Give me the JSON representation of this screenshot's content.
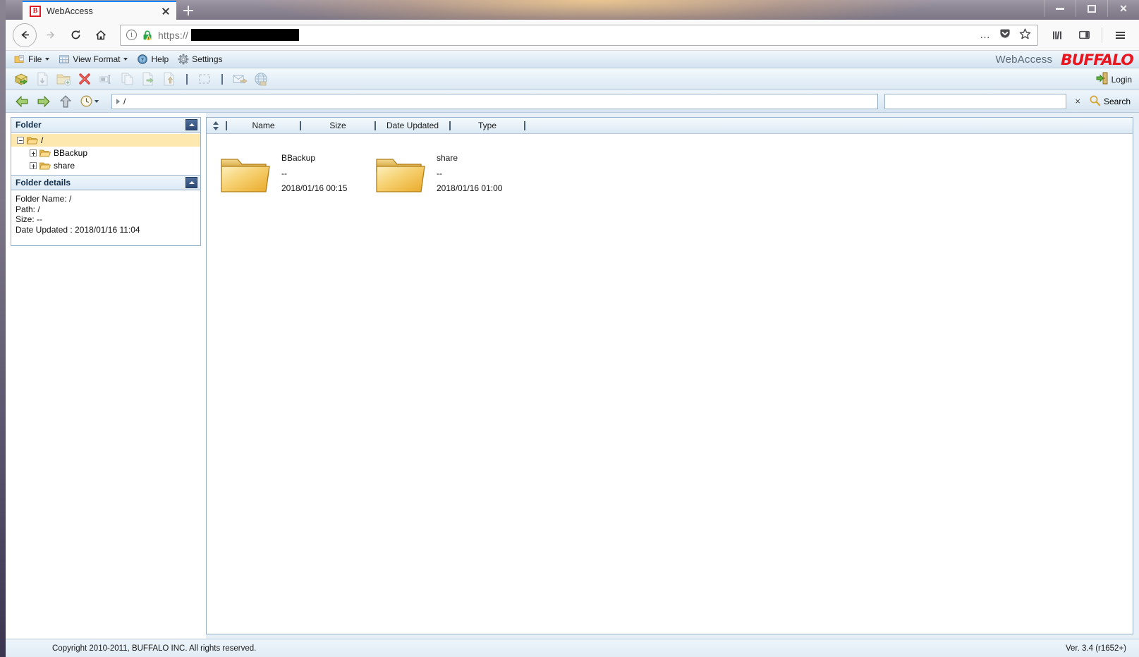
{
  "browser": {
    "tab": {
      "title": "WebAccess",
      "favicon_letter": "B"
    },
    "new_tab_tooltip": "New Tab",
    "url": {
      "scheme": "https://",
      "redacted": true
    },
    "nav": {
      "back": "Back",
      "forward": "Forward",
      "reload": "Reload",
      "home": "Home"
    },
    "toolbar_right": {
      "page_actions": "…",
      "pocket": "Save to Pocket",
      "bookmark": "Bookmark this page",
      "library": "Library",
      "sidebars": "Sidebars",
      "menu": "Open menu"
    },
    "window_controls": {
      "minimize": "Minimize",
      "maximize": "Maximize",
      "close": "Close"
    }
  },
  "app": {
    "brand": {
      "product": "WebAccess",
      "company": "BUFFALO",
      "accent": "#e8141e"
    },
    "menu": [
      {
        "label": "File",
        "icon": "file-folder-icon",
        "has_caret": true
      },
      {
        "label": "View Format",
        "icon": "grid-icon",
        "has_caret": true
      },
      {
        "label": "Help",
        "icon": "help-icon",
        "has_caret": false
      },
      {
        "label": "Settings",
        "icon": "gear-icon",
        "has_caret": false
      }
    ],
    "toolbar": {
      "buttons": [
        {
          "name": "upload-icon",
          "enabled": true
        },
        {
          "name": "download-icon",
          "enabled": false
        },
        {
          "name": "new-folder-icon",
          "enabled": false
        },
        {
          "name": "delete-icon",
          "enabled": true
        },
        {
          "name": "rename-icon",
          "enabled": false
        },
        {
          "name": "copy-icon",
          "enabled": false
        },
        {
          "name": "move-icon",
          "enabled": false
        },
        {
          "name": "paste-icon",
          "enabled": false
        },
        {
          "name": "select-all-icon",
          "enabled": false
        },
        {
          "name": "send-mail-icon",
          "enabled": false
        },
        {
          "name": "web-link-icon",
          "enabled": false
        }
      ],
      "login_label": "Login"
    },
    "navstrip": {
      "path_value": "/",
      "search_value": "",
      "search_clear_label": "×",
      "search_label": "Search"
    },
    "sidebar": {
      "folder_panel": {
        "title": "Folder",
        "collapse_label": "Collapse",
        "tree": [
          {
            "label": "/",
            "level": 0,
            "expanded": true,
            "selected": true
          },
          {
            "label": "BBackup",
            "level": 1,
            "expanded": false,
            "selected": false
          },
          {
            "label": "share",
            "level": 1,
            "expanded": false,
            "selected": false
          }
        ]
      },
      "details_panel": {
        "title": "Folder details",
        "collapse_label": "Collapse",
        "lines": [
          "Folder Name: /",
          "Path: /",
          "Size: --",
          "Date Updated : 2018/01/16 11:04"
        ]
      }
    },
    "fileview": {
      "columns": [
        "Name",
        "Size",
        "Date Updated",
        "Type"
      ],
      "items": [
        {
          "name": "BBackup",
          "size": "--",
          "date": "2018/01/16 00:15",
          "icon": "folder-icon"
        },
        {
          "name": "share",
          "size": "--",
          "date": "2018/01/16 01:00",
          "icon": "folder-icon"
        }
      ]
    },
    "footer": {
      "copyright": "Copyright 2010-2011, BUFFALO INC. All rights reserved.",
      "version": "Ver. 3.4 (r1652+)"
    }
  }
}
